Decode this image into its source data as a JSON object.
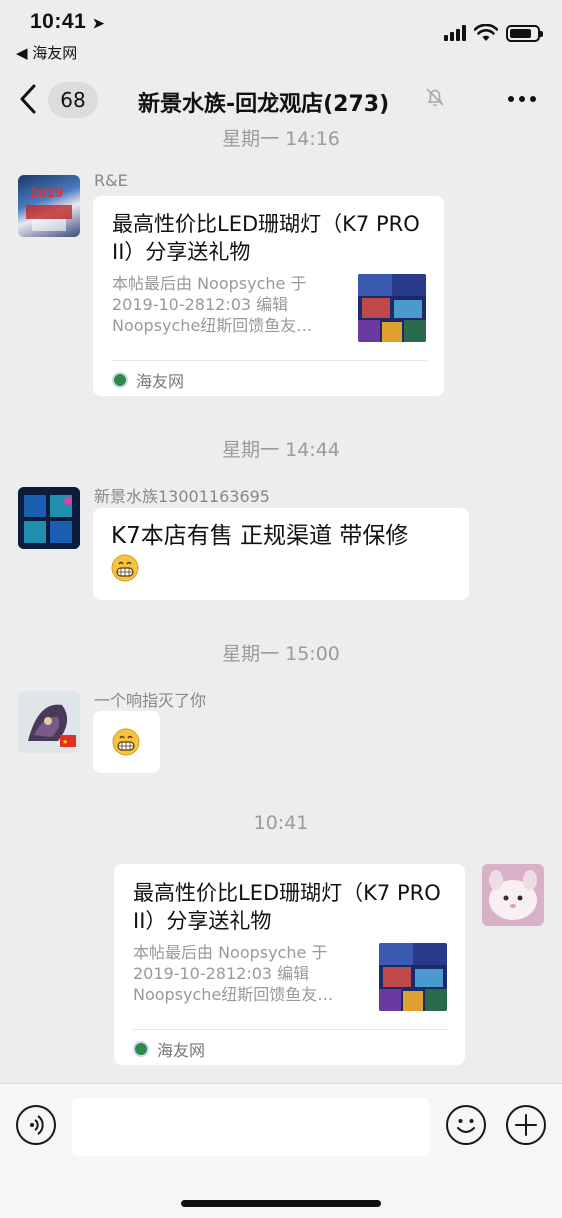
{
  "status_bar": {
    "time": "10:41",
    "back_app": "◀ 海友网"
  },
  "nav": {
    "back_count": "68",
    "title": "新景水族-回龙观店(273)"
  },
  "partial_timestamp": "星期一 14:16",
  "messages": [
    {
      "sender": "R&E",
      "card": {
        "title": "最高性价比LED珊瑚灯（K7 PRO II）分享送礼物",
        "desc_line1": "本帖最后由 Noopsyche 于",
        "desc_line2": "2019-10-2812:03 编辑",
        "desc_line3": "Noopsyche纽斯回馈鱼友…",
        "source": "海友网"
      }
    },
    {
      "timestamp": "星期一 14:44"
    },
    {
      "sender": "新景水族13001163695",
      "text": "K7本店有售  正规渠道 带保修"
    },
    {
      "timestamp": "星期一 15:00"
    },
    {
      "sender": "一个响指灭了你"
    },
    {
      "timestamp": "10:41"
    },
    {
      "card": {
        "title": "最高性价比LED珊瑚灯（K7 PRO II）分享送礼物",
        "desc_line1": "本帖最后由 Noopsyche 于",
        "desc_line2": "2019-10-2812:03 编辑",
        "desc_line3": "Noopsyche纽斯回馈鱼友…",
        "source": "海友网"
      }
    }
  ],
  "icons": {
    "voice": "voice-icon",
    "emoji": "emoji-icon",
    "plus": "plus-icon",
    "mute": "mute-bell-icon"
  }
}
